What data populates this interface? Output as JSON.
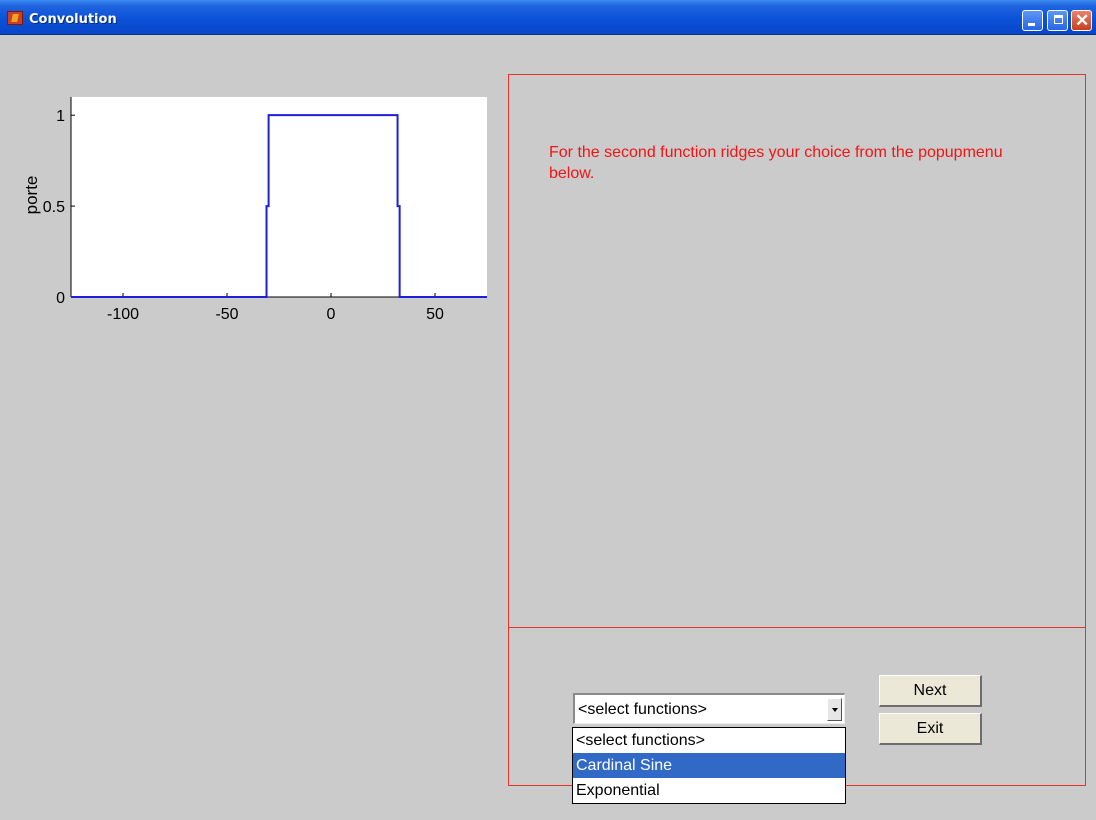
{
  "window": {
    "title": "Convolution"
  },
  "chart_data": {
    "type": "line",
    "title": "",
    "xlabel": "",
    "ylabel": "porte",
    "xlim": [
      -125,
      75
    ],
    "ylim": [
      0,
      1.1
    ],
    "xticks": [
      -100,
      -50,
      0,
      50
    ],
    "yticks": [
      0,
      0.5,
      1
    ],
    "xtick_labels": [
      "-100",
      "-50",
      "0",
      "50"
    ],
    "ytick_labels": [
      "0",
      "0.5",
      "1"
    ],
    "grid": false,
    "series": [
      {
        "color": "#1f1fd8",
        "x": [
          -125,
          -31,
          -31,
          -30,
          -30,
          32,
          32,
          33,
          33,
          75
        ],
        "y": [
          0,
          0,
          0.5,
          0.5,
          1,
          1,
          0.5,
          0.5,
          0,
          0
        ]
      }
    ]
  },
  "instructions": {
    "text": "For the second function ridges your choice from the popupmenu below."
  },
  "popup_menu": {
    "value": "<select functions>",
    "options": [
      "<select functions>",
      "Cardinal Sine",
      "Exponential"
    ],
    "highlighted_index": 1
  },
  "buttons": {
    "next_label": "Next",
    "exit_label": "Exit"
  },
  "colors": {
    "background": "#cbcbcb",
    "accent_red": "#f21414",
    "plot_line": "#1f1fd8",
    "highlight": "#3169c6"
  }
}
